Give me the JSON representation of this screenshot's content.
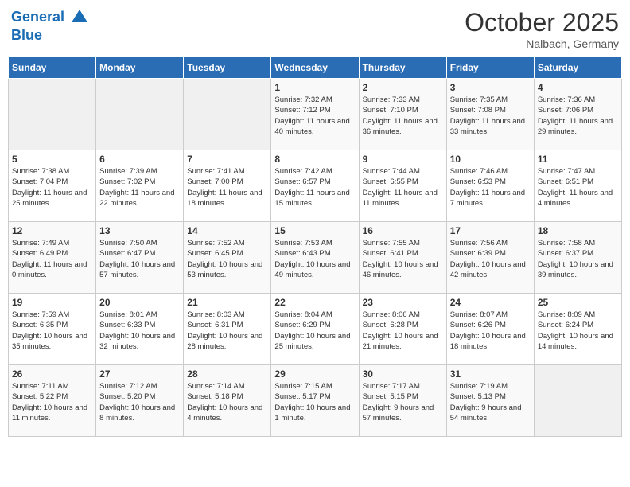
{
  "header": {
    "logo_line1": "General",
    "logo_line2": "Blue",
    "month": "October 2025",
    "location": "Nalbach, Germany"
  },
  "weekdays": [
    "Sunday",
    "Monday",
    "Tuesday",
    "Wednesday",
    "Thursday",
    "Friday",
    "Saturday"
  ],
  "weeks": [
    [
      {
        "day": "",
        "sunrise": "",
        "sunset": "",
        "daylight": ""
      },
      {
        "day": "",
        "sunrise": "",
        "sunset": "",
        "daylight": ""
      },
      {
        "day": "",
        "sunrise": "",
        "sunset": "",
        "daylight": ""
      },
      {
        "day": "1",
        "sunrise": "Sunrise: 7:32 AM",
        "sunset": "Sunset: 7:12 PM",
        "daylight": "Daylight: 11 hours and 40 minutes."
      },
      {
        "day": "2",
        "sunrise": "Sunrise: 7:33 AM",
        "sunset": "Sunset: 7:10 PM",
        "daylight": "Daylight: 11 hours and 36 minutes."
      },
      {
        "day": "3",
        "sunrise": "Sunrise: 7:35 AM",
        "sunset": "Sunset: 7:08 PM",
        "daylight": "Daylight: 11 hours and 33 minutes."
      },
      {
        "day": "4",
        "sunrise": "Sunrise: 7:36 AM",
        "sunset": "Sunset: 7:06 PM",
        "daylight": "Daylight: 11 hours and 29 minutes."
      }
    ],
    [
      {
        "day": "5",
        "sunrise": "Sunrise: 7:38 AM",
        "sunset": "Sunset: 7:04 PM",
        "daylight": "Daylight: 11 hours and 25 minutes."
      },
      {
        "day": "6",
        "sunrise": "Sunrise: 7:39 AM",
        "sunset": "Sunset: 7:02 PM",
        "daylight": "Daylight: 11 hours and 22 minutes."
      },
      {
        "day": "7",
        "sunrise": "Sunrise: 7:41 AM",
        "sunset": "Sunset: 7:00 PM",
        "daylight": "Daylight: 11 hours and 18 minutes."
      },
      {
        "day": "8",
        "sunrise": "Sunrise: 7:42 AM",
        "sunset": "Sunset: 6:57 PM",
        "daylight": "Daylight: 11 hours and 15 minutes."
      },
      {
        "day": "9",
        "sunrise": "Sunrise: 7:44 AM",
        "sunset": "Sunset: 6:55 PM",
        "daylight": "Daylight: 11 hours and 11 minutes."
      },
      {
        "day": "10",
        "sunrise": "Sunrise: 7:46 AM",
        "sunset": "Sunset: 6:53 PM",
        "daylight": "Daylight: 11 hours and 7 minutes."
      },
      {
        "day": "11",
        "sunrise": "Sunrise: 7:47 AM",
        "sunset": "Sunset: 6:51 PM",
        "daylight": "Daylight: 11 hours and 4 minutes."
      }
    ],
    [
      {
        "day": "12",
        "sunrise": "Sunrise: 7:49 AM",
        "sunset": "Sunset: 6:49 PM",
        "daylight": "Daylight: 11 hours and 0 minutes."
      },
      {
        "day": "13",
        "sunrise": "Sunrise: 7:50 AM",
        "sunset": "Sunset: 6:47 PM",
        "daylight": "Daylight: 10 hours and 57 minutes."
      },
      {
        "day": "14",
        "sunrise": "Sunrise: 7:52 AM",
        "sunset": "Sunset: 6:45 PM",
        "daylight": "Daylight: 10 hours and 53 minutes."
      },
      {
        "day": "15",
        "sunrise": "Sunrise: 7:53 AM",
        "sunset": "Sunset: 6:43 PM",
        "daylight": "Daylight: 10 hours and 49 minutes."
      },
      {
        "day": "16",
        "sunrise": "Sunrise: 7:55 AM",
        "sunset": "Sunset: 6:41 PM",
        "daylight": "Daylight: 10 hours and 46 minutes."
      },
      {
        "day": "17",
        "sunrise": "Sunrise: 7:56 AM",
        "sunset": "Sunset: 6:39 PM",
        "daylight": "Daylight: 10 hours and 42 minutes."
      },
      {
        "day": "18",
        "sunrise": "Sunrise: 7:58 AM",
        "sunset": "Sunset: 6:37 PM",
        "daylight": "Daylight: 10 hours and 39 minutes."
      }
    ],
    [
      {
        "day": "19",
        "sunrise": "Sunrise: 7:59 AM",
        "sunset": "Sunset: 6:35 PM",
        "daylight": "Daylight: 10 hours and 35 minutes."
      },
      {
        "day": "20",
        "sunrise": "Sunrise: 8:01 AM",
        "sunset": "Sunset: 6:33 PM",
        "daylight": "Daylight: 10 hours and 32 minutes."
      },
      {
        "day": "21",
        "sunrise": "Sunrise: 8:03 AM",
        "sunset": "Sunset: 6:31 PM",
        "daylight": "Daylight: 10 hours and 28 minutes."
      },
      {
        "day": "22",
        "sunrise": "Sunrise: 8:04 AM",
        "sunset": "Sunset: 6:29 PM",
        "daylight": "Daylight: 10 hours and 25 minutes."
      },
      {
        "day": "23",
        "sunrise": "Sunrise: 8:06 AM",
        "sunset": "Sunset: 6:28 PM",
        "daylight": "Daylight: 10 hours and 21 minutes."
      },
      {
        "day": "24",
        "sunrise": "Sunrise: 8:07 AM",
        "sunset": "Sunset: 6:26 PM",
        "daylight": "Daylight: 10 hours and 18 minutes."
      },
      {
        "day": "25",
        "sunrise": "Sunrise: 8:09 AM",
        "sunset": "Sunset: 6:24 PM",
        "daylight": "Daylight: 10 hours and 14 minutes."
      }
    ],
    [
      {
        "day": "26",
        "sunrise": "Sunrise: 7:11 AM",
        "sunset": "Sunset: 5:22 PM",
        "daylight": "Daylight: 10 hours and 11 minutes."
      },
      {
        "day": "27",
        "sunrise": "Sunrise: 7:12 AM",
        "sunset": "Sunset: 5:20 PM",
        "daylight": "Daylight: 10 hours and 8 minutes."
      },
      {
        "day": "28",
        "sunrise": "Sunrise: 7:14 AM",
        "sunset": "Sunset: 5:18 PM",
        "daylight": "Daylight: 10 hours and 4 minutes."
      },
      {
        "day": "29",
        "sunrise": "Sunrise: 7:15 AM",
        "sunset": "Sunset: 5:17 PM",
        "daylight": "Daylight: 10 hours and 1 minute."
      },
      {
        "day": "30",
        "sunrise": "Sunrise: 7:17 AM",
        "sunset": "Sunset: 5:15 PM",
        "daylight": "Daylight: 9 hours and 57 minutes."
      },
      {
        "day": "31",
        "sunrise": "Sunrise: 7:19 AM",
        "sunset": "Sunset: 5:13 PM",
        "daylight": "Daylight: 9 hours and 54 minutes."
      },
      {
        "day": "",
        "sunrise": "",
        "sunset": "",
        "daylight": ""
      }
    ]
  ]
}
